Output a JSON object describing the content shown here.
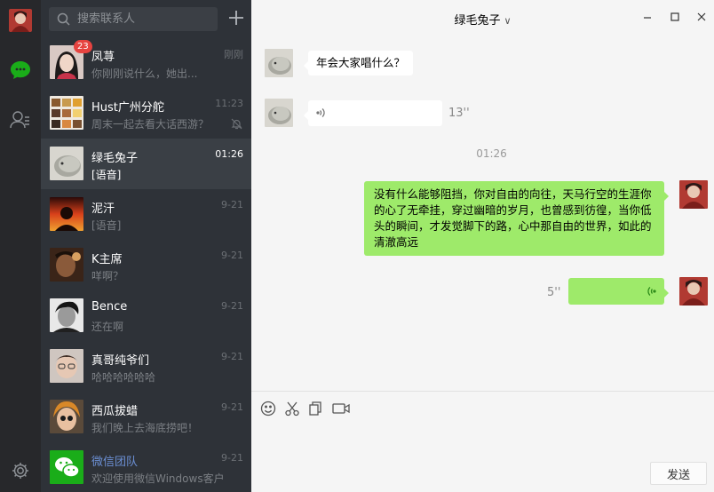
{
  "search": {
    "placeholder": "搜索联系人"
  },
  "chats": [
    {
      "name": "凤荨",
      "preview": "你刚刚说什么，她出...",
      "time": "刚刚",
      "badge": "23"
    },
    {
      "name": "Hust广州分舵",
      "preview": "周末一起去看大话西游？",
      "time": "11:23"
    },
    {
      "name": "绿毛兔子",
      "preview": "[语音]",
      "time": "01:26"
    },
    {
      "name": "泥汗",
      "preview": "[语音]",
      "time": "9-21"
    },
    {
      "name": "K主席",
      "preview": "咩啊？",
      "time": "9-21"
    },
    {
      "name": "Bence",
      "preview": "还在啊",
      "time": "9-21"
    },
    {
      "name": "真哥纯爷们",
      "preview": "哈哈哈哈哈哈",
      "time": "9-21"
    },
    {
      "name": "西瓜拔蜡",
      "preview": "我们晚上去海底捞吧！",
      "time": "9-21"
    },
    {
      "name": "微信团队",
      "preview": "欢迎使用微信Windows客户端...",
      "time": "9-21"
    }
  ],
  "conversation": {
    "title": "绿毛兔子",
    "msg1": "年会大家唱什么？",
    "voice1_duration": "13''",
    "timestamp": "01:26",
    "msg2": "没有什么能够阻挡，你对自由的向往，天马行空的生涯你的心了无牵挂，穿过幽暗的岁月，也曾感到彷徨，当你低头的瞬间，才发觉脚下的路，心中那自由的世界，如此的清澈高远",
    "voice2_duration": "5''"
  },
  "input": {
    "send_label": "发送"
  }
}
